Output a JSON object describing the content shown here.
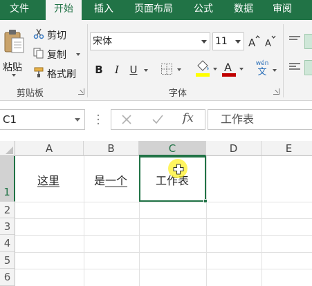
{
  "tabs": [
    {
      "label": "文件",
      "active": false
    },
    {
      "label": "开始",
      "active": true
    },
    {
      "label": "插入",
      "active": false
    },
    {
      "label": "页面布局",
      "active": false
    },
    {
      "label": "公式",
      "active": false
    },
    {
      "label": "数据",
      "active": false
    },
    {
      "label": "审阅",
      "active": false
    }
  ],
  "clipboard": {
    "paste_label": "粘贴",
    "cut_label": "剪切",
    "copy_label": "复制",
    "format_painter_label": "格式刷",
    "group_label": "剪贴板"
  },
  "font": {
    "name": "宋体",
    "size": "11",
    "bold": "B",
    "italic": "I",
    "underline": "U",
    "phonetic_top": "wén",
    "phonetic_bottom": "文",
    "group_label": "字体"
  },
  "formula_bar": {
    "name_box": "C1",
    "fx_label": "fx",
    "content": "工作表"
  },
  "columns": [
    "A",
    "B",
    "C",
    "D",
    "E"
  ],
  "rows": [
    "1",
    "2",
    "3",
    "4",
    "5",
    "6"
  ],
  "cells": {
    "A1": "这里",
    "B1_plain": "是",
    "B1_underlined": "一个",
    "C1": "工作表"
  },
  "colors": {
    "accent": "#217346",
    "font_color": "#c00000",
    "highlight": "#ffff00"
  },
  "icons": [
    "paste-icon",
    "cut-icon",
    "copy-icon",
    "format-painter-icon",
    "grow-font-icon",
    "shrink-font-icon",
    "border-icon",
    "fill-color-icon",
    "font-color-icon",
    "phonetic-icon",
    "cancel-icon",
    "enter-icon",
    "insert-function-icon"
  ]
}
